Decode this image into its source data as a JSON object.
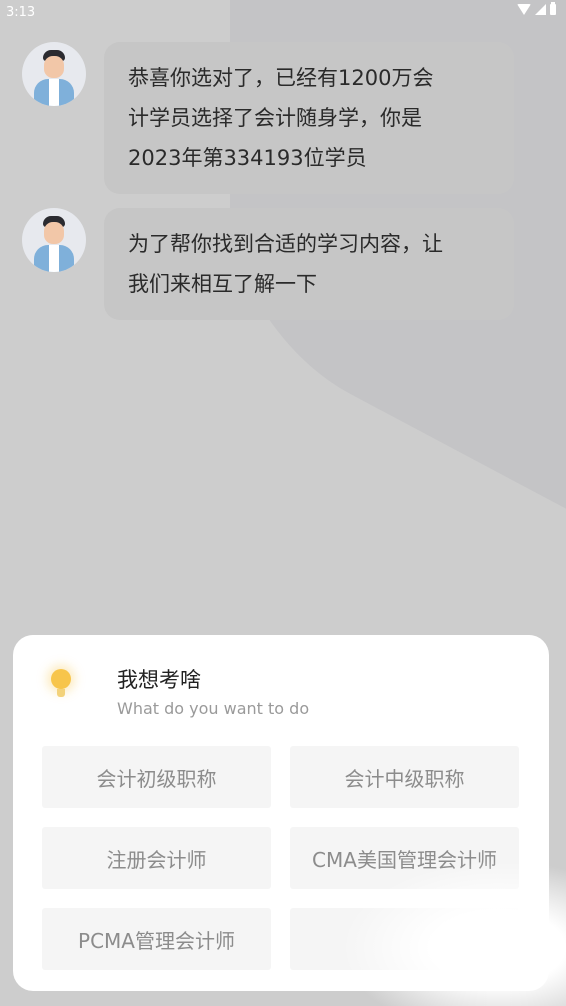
{
  "status": {
    "time": "3:13"
  },
  "messages": [
    {
      "text": "恭喜你选对了，已经有1200万会\n计学员选择了会计随身学，你是\n2023年第334193位学员"
    },
    {
      "text": "为了帮你找到合适的学习内容，让\n我们来相互了解一下"
    }
  ],
  "sheet": {
    "title": "我想考啥",
    "subtitle": "What do you want to do",
    "options": [
      "会计初级职称",
      "会计中级职称",
      "注册会计师",
      "CMA美国管理会计师",
      "PCMA管理会计师",
      ""
    ]
  }
}
